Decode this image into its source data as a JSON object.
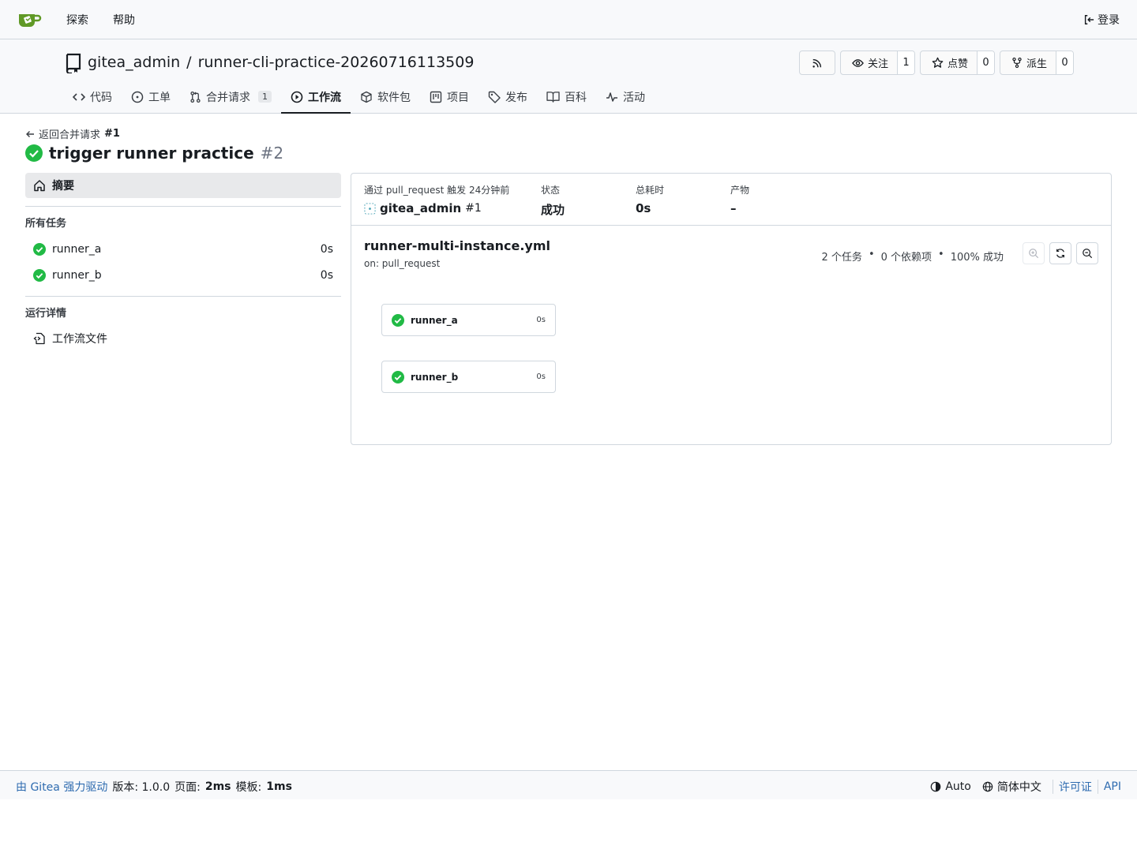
{
  "navbar": {
    "explore": "探索",
    "help": "帮助",
    "login": "登录"
  },
  "repo": {
    "owner": "gitea_admin",
    "separator": "/",
    "name": "runner-cli-practice-20260716113509",
    "watch_label": "关注",
    "watch_count": "1",
    "star_label": "点赞",
    "star_count": "0",
    "fork_label": "派生",
    "fork_count": "0"
  },
  "tabs": {
    "code": "代码",
    "issues": "工单",
    "pulls": "合并请求",
    "pulls_count": "1",
    "actions": "工作流",
    "packages": "软件包",
    "projects": "项目",
    "releases": "发布",
    "wiki": "百科",
    "activity": "活动"
  },
  "run": {
    "back_text": "返回合并请求",
    "back_ref": "#1",
    "title": "trigger runner practice",
    "number": "#2"
  },
  "sidebar": {
    "summary": "摘要",
    "all_jobs": "所有任务",
    "jobs": [
      {
        "name": "runner_a",
        "duration": "0s"
      },
      {
        "name": "runner_b",
        "duration": "0s"
      }
    ],
    "run_details": "运行详情",
    "workflow_file": "工作流文件"
  },
  "meta": {
    "trigger_label": "通过 pull_request 触发 24分钟前",
    "trigger_user": "gitea_admin",
    "trigger_ref": "#1",
    "status_label": "状态",
    "status_value": "成功",
    "duration_label": "总耗时",
    "duration_value": "0s",
    "artifacts_label": "产物",
    "artifacts_value": "–"
  },
  "workflow": {
    "filename": "runner-multi-instance.yml",
    "on": "on: pull_request",
    "stat_jobs": "2 个任务",
    "stat_deps": "0 个依赖项",
    "stat_success": "100% 成功",
    "dot": "•",
    "nodes": [
      {
        "name": "runner_a",
        "duration": "0s"
      },
      {
        "name": "runner_b",
        "duration": "0s"
      }
    ]
  },
  "footer": {
    "powered": "由 Gitea 强力驱动",
    "version": "版本: 1.0.0",
    "page_label": "页面:",
    "page_time": "2ms",
    "template_label": "模板:",
    "template_time": "1ms",
    "theme": "Auto",
    "language": "简体中文",
    "license": "许可证",
    "api": "API"
  },
  "colors": {
    "success": "#21ba45",
    "link": "#2f6cb0",
    "border": "#d0d7de",
    "header_bg": "#f8f9fb"
  },
  "icons": [
    "gitea-logo-icon",
    "sign-in-icon",
    "repo-icon",
    "rss-icon",
    "eye-icon",
    "star-icon",
    "fork-icon",
    "code-icon",
    "issue-icon",
    "pull-request-icon",
    "play-icon",
    "package-icon",
    "project-icon",
    "tag-icon",
    "book-icon",
    "pulse-icon",
    "arrow-left-icon",
    "check-circle-icon",
    "home-icon",
    "file-code-icon",
    "avatar-icon",
    "zoom-in-icon",
    "reset-icon",
    "zoom-out-icon",
    "theme-icon",
    "globe-icon"
  ]
}
